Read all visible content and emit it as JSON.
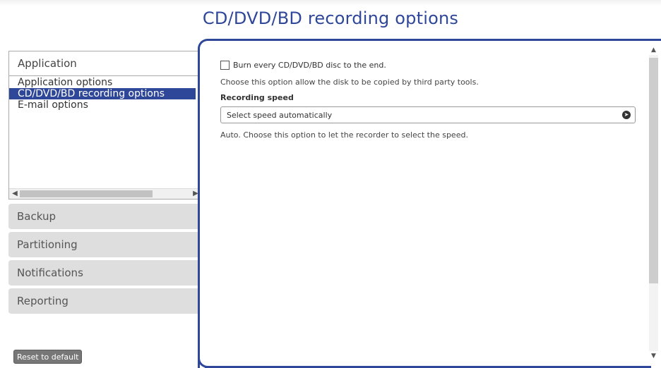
{
  "page_title": "CD/DVD/BD recording options",
  "sidebar": {
    "open_section": {
      "label": "Application",
      "items": [
        {
          "label": "Application options",
          "selected": false
        },
        {
          "label": "CD/DVD/BD recording options",
          "selected": true
        },
        {
          "label": "E-mail options",
          "selected": false
        }
      ]
    },
    "sections": [
      {
        "label": "Backup"
      },
      {
        "label": "Partitioning"
      },
      {
        "label": "Notifications"
      },
      {
        "label": "Reporting"
      }
    ],
    "reset_label": "Reset to default"
  },
  "main": {
    "burn_checkbox_label": "Burn every CD/DVD/BD disc to the end.",
    "burn_checkbox_checked": false,
    "burn_description": "Choose this option allow the disk to be copied by third party tools.",
    "recording_speed_label": "Recording speed",
    "recording_speed_value": "Select speed automatically",
    "recording_speed_description": "Auto. Choose this option to let the recorder to select the speed."
  },
  "icons": {
    "dropdown": "circle-chevron-right-icon",
    "scroll_left": "arrow-left-icon",
    "scroll_right": "arrow-right-icon",
    "scroll_up": "arrow-up-icon",
    "scroll_down": "arrow-down-icon"
  },
  "colors": {
    "accent": "#2f4799",
    "section_bg": "#dedede",
    "reset_bg": "#777777"
  }
}
